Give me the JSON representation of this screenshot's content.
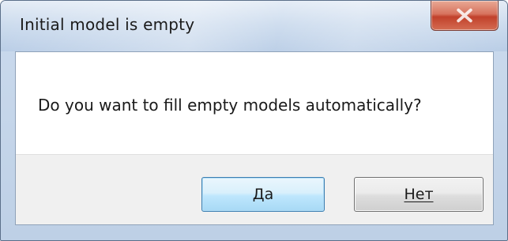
{
  "window": {
    "title": "Initial model is empty",
    "close_icon": "close-icon"
  },
  "message": {
    "text": "Do you want to fill empty models automatically?"
  },
  "buttons": {
    "yes_label": "Да",
    "no_label": "Нет"
  },
  "colors": {
    "titlebar": "#cddcee",
    "close_button": "#c1412b",
    "default_button_border": "#3c7fb1",
    "button_area": "#f0f0f0"
  }
}
